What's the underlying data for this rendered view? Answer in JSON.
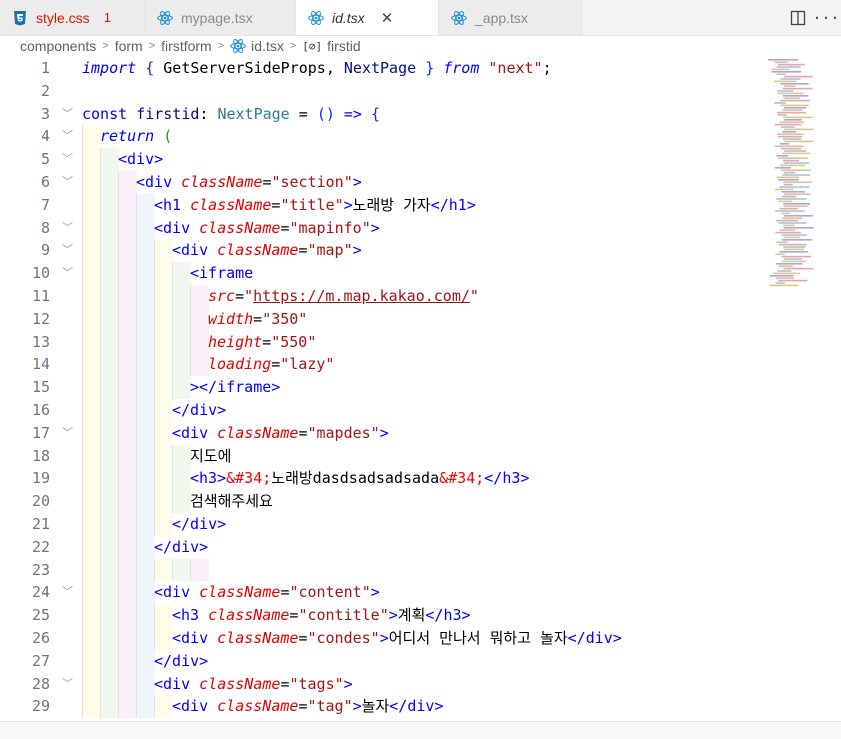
{
  "tabs": [
    {
      "name": "style.css",
      "badge": "1",
      "kind": "css",
      "state": "error"
    },
    {
      "name": "mypage.tsx",
      "kind": "react",
      "state": "inactive"
    },
    {
      "name": "id.tsx",
      "kind": "react",
      "state": "active",
      "close": "✕"
    },
    {
      "name": "_app.tsx",
      "kind": "react",
      "state": "inactive"
    }
  ],
  "actions": {
    "split": "split-editor-icon",
    "more": "···"
  },
  "breadcrumb": {
    "items": [
      "components",
      "form",
      "firstform",
      "id.tsx",
      "firstid"
    ],
    "symbol": "[⊘]"
  },
  "code_lines": [
    {
      "n": "1",
      "fold": false,
      "indent": 0,
      "html": "<span class='kw'>import</span> <span class='brk'>{</span> GetServerSideProps, <span class='im'>NextPage</span> <span class='brk'>}</span> <span class='kw'>from</span> <span class='str'>\"next\"</span>;"
    },
    {
      "n": "2",
      "fold": false,
      "indent": 0,
      "html": ""
    },
    {
      "n": "3",
      "fold": true,
      "indent": 0,
      "html": "<span class='kw2'>const</span> <span class='id'>firstid</span>: <span class='ty'>NextPage</span> = <span class='brk'>()</span> <span class='kw2'>=&gt;</span> <span class='brk'>{</span>"
    },
    {
      "n": "4",
      "fold": true,
      "indent": 1,
      "html": "<span class='kw'>return</span> <span class='brk2'>(</span>"
    },
    {
      "n": "5",
      "fold": true,
      "indent": 2,
      "html": "<span class='tagb'>&lt;div&gt;</span>"
    },
    {
      "n": "6",
      "fold": true,
      "indent": 3,
      "html": "<span class='tagb'>&lt;div</span> <span class='attr'>className</span>=<span class='str'>\"section\"</span><span class='tagb'>&gt;</span>"
    },
    {
      "n": "7",
      "fold": false,
      "indent": 4,
      "html": "<span class='tagb'>&lt;h1</span> <span class='attr'>className</span>=<span class='str'>\"title\"</span><span class='tagb'>&gt;</span>노래방 가자<span class='tagb'>&lt;/h1&gt;</span>"
    },
    {
      "n": "8",
      "fold": true,
      "indent": 4,
      "html": "<span class='tagb'>&lt;div</span> <span class='attr'>className</span>=<span class='str'>\"mapinfo\"</span><span class='tagb'>&gt;</span>"
    },
    {
      "n": "9",
      "fold": true,
      "indent": 5,
      "html": "<span class='tagb'>&lt;div</span> <span class='attr'>className</span>=<span class='str'>\"map\"</span><span class='tagb'>&gt;</span>"
    },
    {
      "n": "10",
      "fold": true,
      "indent": 6,
      "html": "<span class='tagb'>&lt;iframe</span>"
    },
    {
      "n": "11",
      "fold": false,
      "indent": 7,
      "html": "<span class='attr'>src</span>=<span class='str'>\"<span class='url'>https://m.map.kakao.com/</span>\"</span>"
    },
    {
      "n": "12",
      "fold": false,
      "indent": 7,
      "html": "<span class='attr'>width</span>=<span class='str'>\"350\"</span>"
    },
    {
      "n": "13",
      "fold": false,
      "indent": 7,
      "html": "<span class='attr'>height</span>=<span class='str'>\"550\"</span>"
    },
    {
      "n": "14",
      "fold": false,
      "indent": 7,
      "html": "<span class='attr'>loading</span>=<span class='str'>\"lazy\"</span>"
    },
    {
      "n": "15",
      "fold": false,
      "indent": 6,
      "html": "<span class='tagb'>&gt;&lt;/iframe&gt;</span>"
    },
    {
      "n": "16",
      "fold": false,
      "indent": 5,
      "html": "<span class='tagb'>&lt;/div&gt;</span>"
    },
    {
      "n": "17",
      "fold": true,
      "indent": 5,
      "html": "<span class='tagb'>&lt;div</span> <span class='attr'>className</span>=<span class='str'>\"mapdes\"</span><span class='tagb'>&gt;</span>"
    },
    {
      "n": "18",
      "fold": false,
      "indent": 6,
      "html": "지도에"
    },
    {
      "n": "19",
      "fold": false,
      "indent": 6,
      "html": "<span class='tagb'>&lt;h3&gt;</span><span class='ent'>&amp;#34;</span>노래방dasdsadsadsada<span class='ent'>&amp;#34;</span><span class='tagb'>&lt;/h3&gt;</span>"
    },
    {
      "n": "20",
      "fold": false,
      "indent": 6,
      "html": "검색해주세요"
    },
    {
      "n": "21",
      "fold": false,
      "indent": 5,
      "html": "<span class='tagb'>&lt;/div&gt;</span>"
    },
    {
      "n": "22",
      "fold": false,
      "indent": 4,
      "html": "<span class='tagb'>&lt;/div&gt;</span>"
    },
    {
      "n": "23",
      "fold": false,
      "indent": 0,
      "html": ""
    },
    {
      "n": "24",
      "fold": true,
      "indent": 4,
      "html": "<span class='tagb'>&lt;div</span> <span class='attr'>className</span>=<span class='str'>\"content\"</span><span class='tagb'>&gt;</span>"
    },
    {
      "n": "25",
      "fold": false,
      "indent": 5,
      "html": "<span class='tagb'>&lt;h3</span> <span class='attr'>className</span>=<span class='str'>\"contitle\"</span><span class='tagb'>&gt;</span>계획<span class='tagb'>&lt;/h3&gt;</span>"
    },
    {
      "n": "26",
      "fold": false,
      "indent": 5,
      "html": "<span class='tagb'>&lt;div</span> <span class='attr'>className</span>=<span class='str'>\"condes\"</span><span class='tagb'>&gt;</span>어디서 만나서 뭐하고 놀자<span class='tagb'>&lt;/div&gt;</span>"
    },
    {
      "n": "27",
      "fold": false,
      "indent": 4,
      "html": "<span class='tagb'>&lt;/div&gt;</span>"
    },
    {
      "n": "28",
      "fold": true,
      "indent": 4,
      "html": "<span class='tagb'>&lt;div</span> <span class='attr'>className</span>=<span class='str'>\"tags\"</span><span class='tagb'>&gt;</span>"
    },
    {
      "n": "29",
      "fold": false,
      "indent": 5,
      "html": "<span class='tagb'>&lt;div</span> <span class='attr'>className</span>=<span class='str'>\"tag\"</span><span class='tagb'>&gt;</span>놀자<span class='tagb'>&lt;/div&gt;</span>"
    }
  ]
}
